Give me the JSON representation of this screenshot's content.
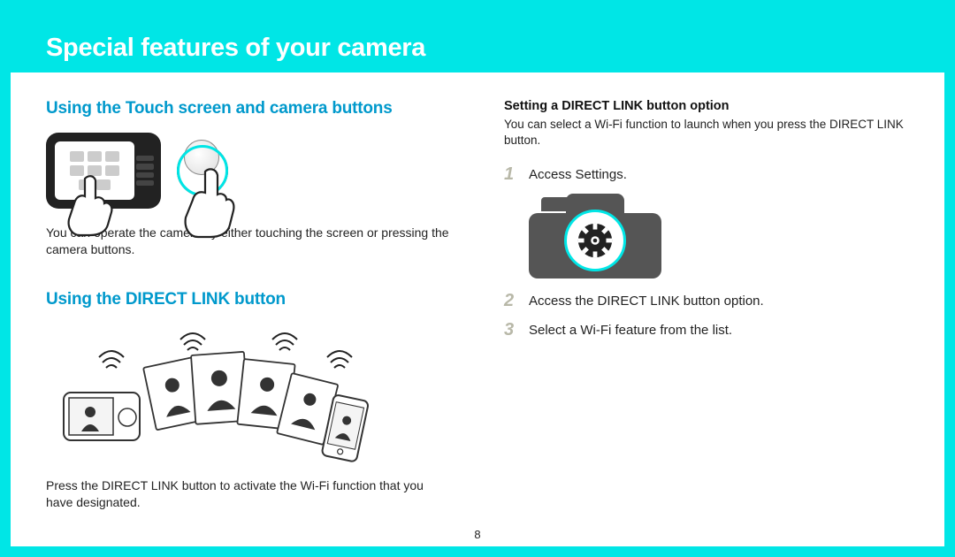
{
  "page": {
    "title": "Special features of your camera",
    "number": "8"
  },
  "left": {
    "heading1": "Using the Touch screen and camera buttons",
    "body1": "You can operate the camera by either touching the screen or pressing the camera buttons.",
    "heading2": "Using the DIRECT LINK button",
    "body2": "Press the DIRECT LINK button to activate the Wi-Fi function that you have designated."
  },
  "right": {
    "subheading": "Setting a DIRECT LINK button option",
    "subtext": "You can select a Wi-Fi function to launch when you press the DIRECT LINK button.",
    "steps": [
      {
        "num": "1",
        "text": "Access Settings."
      },
      {
        "num": "2",
        "text": "Access the DIRECT LINK button option."
      },
      {
        "num": "3",
        "text": "Select a Wi-Fi feature from the list."
      }
    ]
  },
  "icons": {
    "camera_touch": "camera-touchscreen-illustration",
    "camera_button": "camera-button-press-illustration",
    "direct_link": "direct-link-wifi-illustration",
    "camera_settings": "camera-settings-gear-illustration"
  },
  "colors": {
    "accent": "#00e6e6",
    "heading": "#0099cc"
  }
}
